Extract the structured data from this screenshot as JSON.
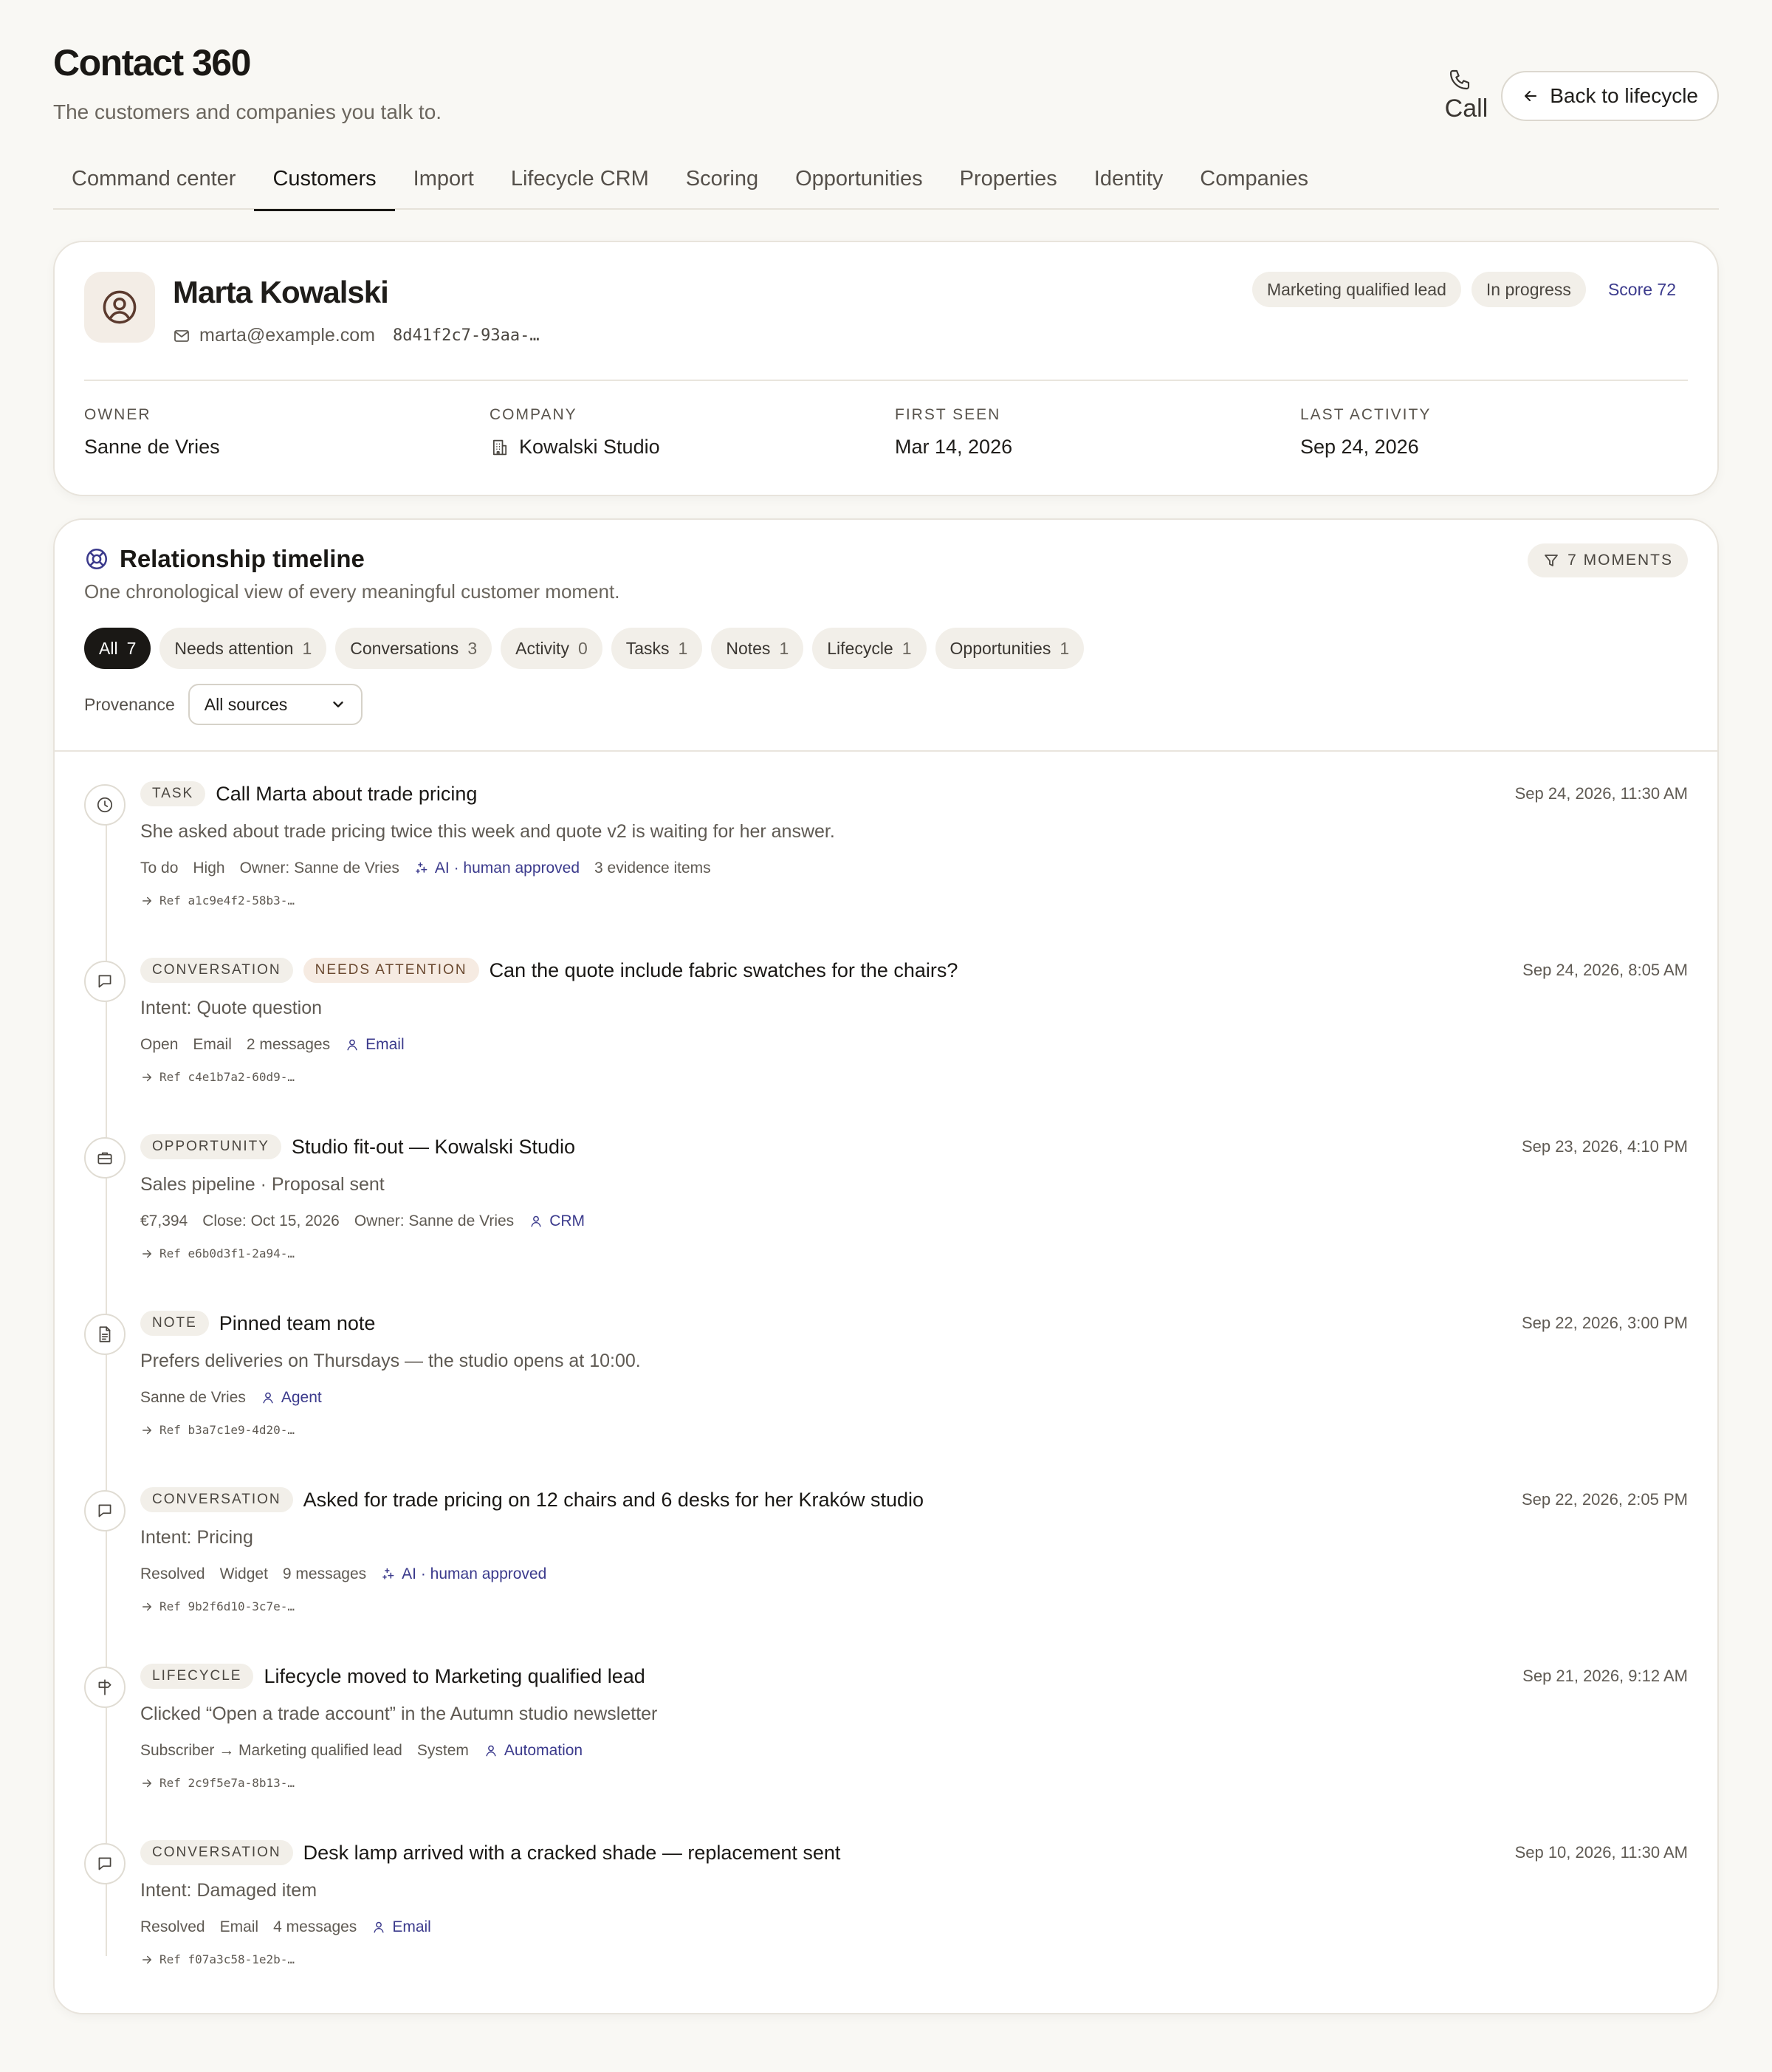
{
  "header": {
    "title": "Contact 360",
    "subtitle": "The customers and companies you talk to.",
    "call_label": "Call",
    "back_label": "Back to lifecycle"
  },
  "tabs": [
    {
      "label": "Command center",
      "active": false
    },
    {
      "label": "Customers",
      "active": true
    },
    {
      "label": "Import",
      "active": false
    },
    {
      "label": "Lifecycle CRM",
      "active": false
    },
    {
      "label": "Scoring",
      "active": false
    },
    {
      "label": "Opportunities",
      "active": false
    },
    {
      "label": "Properties",
      "active": false
    },
    {
      "label": "Identity",
      "active": false
    },
    {
      "label": "Companies",
      "active": false
    }
  ],
  "profile": {
    "name": "Marta Kowalski",
    "email": "marta@example.com",
    "id": "8d41f2c7-93aa-…",
    "badges": [
      "Marketing qualified lead",
      "In progress"
    ],
    "score": "Score 72",
    "facts": [
      {
        "label": "Owner",
        "value": "Sanne de Vries"
      },
      {
        "label": "Company",
        "value": "Kowalski Studio"
      },
      {
        "label": "First seen",
        "value": "Mar 14, 2026"
      },
      {
        "label": "Last activity",
        "value": "Sep 24, 2026"
      }
    ]
  },
  "timeline": {
    "title": "Relationship timeline",
    "subtitle": "One chronological view of every meaningful customer moment.",
    "moments": "7 moments",
    "filters": [
      {
        "label": "All",
        "count": "7",
        "active": true
      },
      {
        "label": "Needs attention",
        "count": "1",
        "active": false
      },
      {
        "label": "Conversations",
        "count": "3",
        "active": false
      },
      {
        "label": "Activity",
        "count": "0",
        "active": false
      },
      {
        "label": "Tasks",
        "count": "1",
        "active": false
      },
      {
        "label": "Notes",
        "count": "1",
        "active": false
      },
      {
        "label": "Lifecycle",
        "count": "1",
        "active": false
      },
      {
        "label": "Opportunities",
        "count": "1",
        "active": false
      }
    ],
    "provenance_label": "Provenance",
    "provenance_value": "All sources",
    "events": [
      {
        "icon": "clock-icon",
        "tags": [
          "Task"
        ],
        "attention": "",
        "title": "Call Marta about trade pricing",
        "time": "Sep 24, 2026, 11:30 AM",
        "desc": "She asked about trade pricing twice this week and quote v2 is waiting for her answer.",
        "meta": [
          "To do",
          "High",
          "Owner: Sanne de Vries"
        ],
        "source": "AI · human approved",
        "source_icon": "sparkle-icon",
        "extra": "3 evidence items",
        "ref": "Ref a1c9e4f2-58b3-…"
      },
      {
        "icon": "chat-icon",
        "tags": [
          "Conversation"
        ],
        "attention": "Needs attention",
        "title": "Can the quote include fabric swatches for the chairs?",
        "time": "Sep 24, 2026, 8:05 AM",
        "desc": "Intent: Quote question",
        "meta": [
          "Open",
          "Email",
          "2 messages"
        ],
        "source": "Email",
        "source_icon": "person-icon",
        "extra": "",
        "ref": "Ref c4e1b7a2-60d9-…"
      },
      {
        "icon": "briefcase-icon",
        "tags": [
          "Opportunity"
        ],
        "attention": "",
        "title": "Studio fit-out — Kowalski Studio",
        "time": "Sep 23, 2026, 4:10 PM",
        "desc": "Sales pipeline · Proposal sent",
        "meta": [
          "€7,394",
          "Close: Oct 15, 2026",
          "Owner: Sanne de Vries"
        ],
        "source": "CRM",
        "source_icon": "person-icon",
        "extra": "",
        "ref": "Ref e6b0d3f1-2a94-…"
      },
      {
        "icon": "document-icon",
        "tags": [
          "Note"
        ],
        "attention": "",
        "title": "Pinned team note",
        "time": "Sep 22, 2026, 3:00 PM",
        "desc": "Prefers deliveries on Thursdays — the studio opens at 10:00.",
        "meta": [
          "Sanne de Vries"
        ],
        "source": "Agent",
        "source_icon": "person-icon",
        "extra": "",
        "ref": "Ref b3a7c1e9-4d20-…"
      },
      {
        "icon": "chat-icon",
        "tags": [
          "Conversation"
        ],
        "attention": "",
        "title": "Asked for trade pricing on 12 chairs and 6 desks for her Kraków studio",
        "time": "Sep 22, 2026, 2:05 PM",
        "desc": "Intent: Pricing",
        "meta": [
          "Resolved",
          "Widget",
          "9 messages"
        ],
        "source": "AI · human approved",
        "source_icon": "sparkle-icon",
        "extra": "",
        "ref": "Ref 9b2f6d10-3c7e-…"
      },
      {
        "icon": "signpost-icon",
        "tags": [
          "Lifecycle"
        ],
        "attention": "",
        "title": "Lifecycle moved to Marketing qualified lead",
        "time": "Sep 21, 2026, 9:12 AM",
        "desc": "Clicked “Open a trade account” in the Autumn studio newsletter",
        "meta": [
          "Subscriber → Marketing qualified lead",
          "System"
        ],
        "source": "Automation",
        "source_icon": "person-icon",
        "extra": "",
        "ref": "Ref 2c9f5e7a-8b13-…"
      },
      {
        "icon": "chat-icon",
        "tags": [
          "Conversation"
        ],
        "attention": "",
        "title": "Desk lamp arrived with a cracked shade — replacement sent",
        "time": "Sep 10, 2026, 11:30 AM",
        "desc": "Intent: Damaged item",
        "meta": [
          "Resolved",
          "Email",
          "4 messages"
        ],
        "source": "Email",
        "source_icon": "person-icon",
        "extra": "",
        "ref": "Ref f07a3c58-1e2b-…"
      }
    ]
  },
  "colors": {
    "background": "#f9f8f4",
    "accent": "#3b3a8c",
    "ink": "#1a1815"
  }
}
